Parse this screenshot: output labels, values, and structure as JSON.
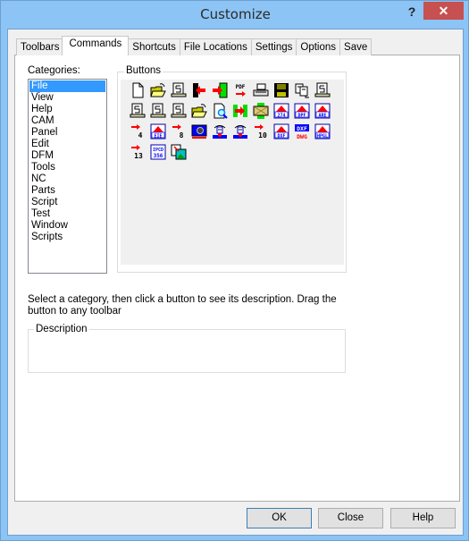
{
  "window": {
    "title": "Customize",
    "help_label": "?",
    "close_label": "✕"
  },
  "tabs": [
    {
      "label": "Toolbars",
      "active": false
    },
    {
      "label": "Commands",
      "active": true
    },
    {
      "label": "Shortcuts",
      "active": false
    },
    {
      "label": "File Locations",
      "active": false
    },
    {
      "label": "Settings",
      "active": false
    },
    {
      "label": "Options",
      "active": false
    },
    {
      "label": "Save",
      "active": false
    }
  ],
  "categories": {
    "label": "Categories:",
    "selected": "File",
    "items": [
      "File",
      "View",
      "Help",
      "CAM",
      "Panel",
      "Edit",
      "DFM",
      "Tools",
      "NC",
      "Parts",
      "Script",
      "Test",
      "Window",
      "Scripts"
    ]
  },
  "buttons": {
    "label": "Buttons",
    "rows": [
      [
        "new-file-icon",
        "open-folder-icon",
        "printer-doc-icon",
        "import-left-icon",
        "export-right-icon",
        "pdf-export-icon",
        "print-icon",
        "save-disk-icon",
        "copy-doc-icon",
        "printer-doc-icon"
      ],
      [
        "printer-doc-icon",
        "printer-doc-icon",
        "printer-doc-icon",
        "open-folder-icon",
        "print-preview-icon",
        "import-export-icon",
        "envelope-icon",
        "import-274x-icon",
        "import-dpf-icon",
        "import-are-icon"
      ],
      [
        "export-4-icon",
        "import-eie-icon",
        "export-8-icon",
        "camera-board-icon",
        "robot-icon",
        "robot-icon",
        "export-10-icon",
        "import-dxf-icon",
        "dxf-dwg-icon",
        "import-hpgl-icon"
      ],
      [
        "export-13-icon",
        "ipc-d-356-icon",
        "image-copy-icon"
      ]
    ],
    "texts": {
      "pdf": "PDF",
      "n4": "4",
      "n8": "8",
      "n10": "10",
      "n13": "13",
      "t274": "274",
      "dpf": "DPF",
      "are": "ARE",
      "eie": "EIE",
      "dxf": "DXF",
      "dwg": "DWG",
      "hpgl": "HPGL",
      "ipc1": "IPCD",
      "ipc2": "356"
    }
  },
  "hint": "Select a category, then click a button to see its description. Drag the button to any toolbar",
  "description": {
    "label": "Description",
    "value": ""
  },
  "footer": {
    "ok": "OK",
    "close": "Close",
    "help": "Help"
  },
  "colors": {
    "frame": "#8cc4f5",
    "close_button": "#c75050",
    "selection": "#3399ff"
  }
}
